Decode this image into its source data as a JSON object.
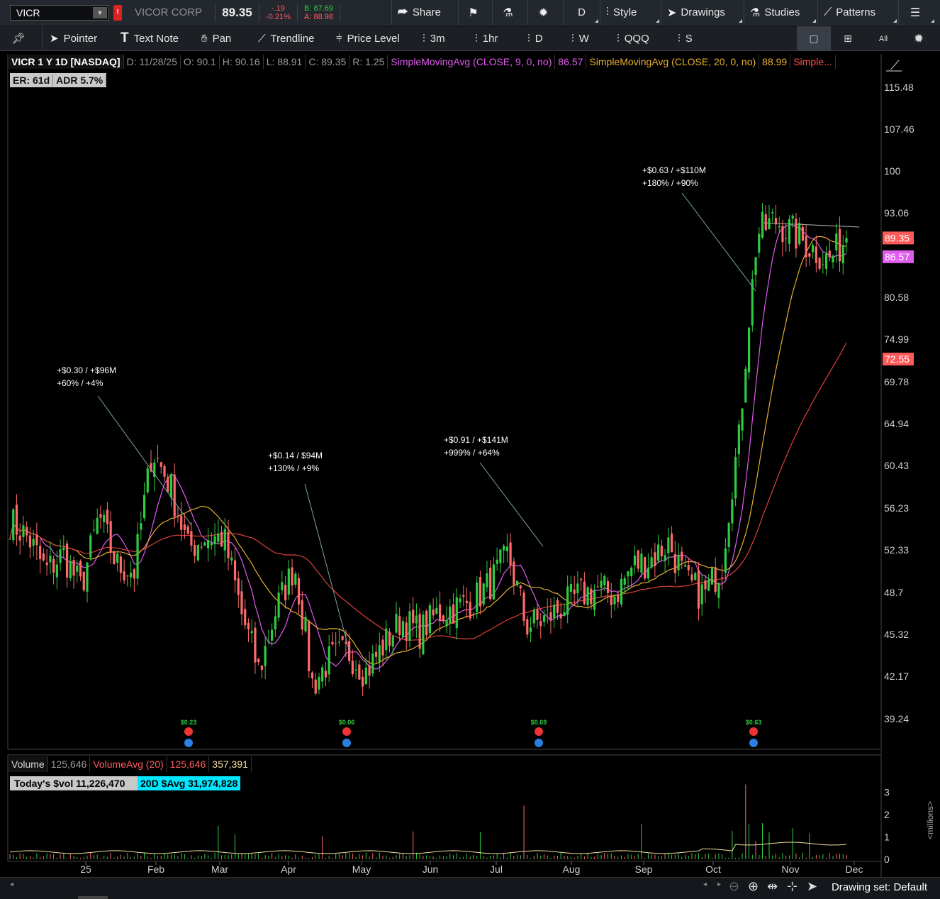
{
  "topbar": {
    "symbol": "VICR",
    "company": "VICOR CORP",
    "last": "89.35",
    "change": "-.19",
    "change_pct": "-0.21%",
    "bid": "B: 87.69",
    "ask": "A: 88.98",
    "share_label": "Share",
    "aggregation": "D",
    "style_label": "Style",
    "drawings_label": "Drawings",
    "studies_label": "Studies",
    "patterns_label": "Patterns"
  },
  "toolbar": {
    "pointer": "Pointer",
    "text_note": "Text Note",
    "pan": "Pan",
    "trendline": "Trendline",
    "price_level": "Price Level",
    "t3m": "3m",
    "t1hr": "1hr",
    "tD": "D",
    "tW": "W",
    "tQQQ": "QQQ",
    "tS": "S",
    "all": "All"
  },
  "chart_info": {
    "title": "VICR 1 Y 1D [NASDAQ]",
    "date": "D: 11/28/25",
    "open": "O: 90.1",
    "high": "H: 90.16",
    "low": "L: 88.91",
    "close": "C: 89.35",
    "range": "R: 1.25",
    "sma9_label": "SimpleMovingAvg (CLOSE, 9, 0, no)",
    "sma9_value": "86.57",
    "sma20_label": "SimpleMovingAvg (CLOSE, 20, 0, no)",
    "sma20_value": "88.99",
    "sma50_label": "Simple...",
    "er": "ER: 61d",
    "adr": "ADR 5.7%"
  },
  "price_axis": [
    "115.48",
    "107.46",
    "100",
    "93.06",
    "80.58",
    "74.99",
    "69.78",
    "64.94",
    "60.43",
    "56.23",
    "52.33",
    "48.7",
    "45.32",
    "42.17",
    "39.24"
  ],
  "price_markers": {
    "last": "89.35",
    "sma9": "86.57",
    "sma50": "72.55",
    "last_color": "#ff5a5a",
    "sma9_color": "#e05cf0",
    "sma50_color": "#ff5a5a"
  },
  "annotations": [
    {
      "l1": "+$0.30 / +$96M",
      "l2": "+60% / +4%"
    },
    {
      "l1": "+$0.14 / $94M",
      "l2": "+130% / +9%"
    },
    {
      "l1": "+$0.91 / +$141M",
      "l2": "+999% / +64%"
    },
    {
      "l1": "+$0.63 / +$110M",
      "l2": "+180% / +90%"
    }
  ],
  "earnings": [
    {
      "eps": "$0.23"
    },
    {
      "eps": "$0.06"
    },
    {
      "eps": "$0.69"
    },
    {
      "eps": "$0.63"
    }
  ],
  "volume_info": {
    "label": "Volume",
    "value": "125,646",
    "avg_label": "VolumeAvg (20)",
    "avg_value": "125,646",
    "avg_value2": "357,391",
    "today_vol": "Today's $vol 11,226,470",
    "avg_dollar": "20D $Avg 31,974,828",
    "axis": [
      "3",
      "2",
      "1",
      "0"
    ],
    "units": "<millions>"
  },
  "time_axis": [
    "25",
    "Feb",
    "Mar",
    "Apr",
    "May",
    "Jun",
    "Jul",
    "Aug",
    "Sep",
    "Oct",
    "Nov",
    "Dec"
  ],
  "bottom": {
    "drawing_set": "Drawing set: Default"
  },
  "colors": {
    "up": "#2ecc40",
    "down": "#ff6b6b",
    "sma9": "#e05cf0",
    "sma20": "#e8b030",
    "sma50": "#e0403a"
  },
  "chart_data": {
    "type": "candlestick",
    "x": [
      "2025-01-02",
      "2025-01-09",
      "2025-01-16",
      "2025-01-23",
      "2025-01-30",
      "2025-02-06",
      "2025-02-13",
      "2025-02-20",
      "2025-02-27",
      "2025-03-06",
      "2025-03-13",
      "2025-03-20",
      "2025-03-27",
      "2025-04-03",
      "2025-04-10",
      "2025-04-17",
      "2025-04-24",
      "2025-05-01",
      "2025-05-08",
      "2025-05-15",
      "2025-05-22",
      "2025-05-29",
      "2025-06-05",
      "2025-06-12",
      "2025-06-19",
      "2025-06-26",
      "2025-07-03",
      "2025-07-10",
      "2025-07-17",
      "2025-07-24",
      "2025-07-31",
      "2025-08-07",
      "2025-08-14",
      "2025-08-21",
      "2025-08-28",
      "2025-09-04",
      "2025-09-11",
      "2025-09-18",
      "2025-09-25",
      "2025-10-02",
      "2025-10-09",
      "2025-10-16",
      "2025-10-23",
      "2025-10-30",
      "2025-11-06",
      "2025-11-13",
      "2025-11-20",
      "2025-11-28"
    ],
    "close": [
      55.0,
      53.5,
      50.5,
      52.0,
      49.0,
      55.5,
      51.0,
      50.5,
      62.0,
      58.5,
      52.5,
      53.5,
      53.5,
      47.0,
      42.5,
      47.5,
      51.0,
      41.5,
      43.5,
      44.0,
      42.5,
      44.5,
      46.5,
      45.5,
      47.0,
      47.5,
      48.0,
      49.5,
      52.0,
      46.0,
      46.5,
      47.5,
      48.5,
      49.0,
      48.5,
      51.0,
      51.5,
      53.0,
      49.5,
      48.5,
      51.0,
      64.0,
      90.0,
      92.0,
      90.0,
      88.0,
      86.0,
      89.35
    ],
    "series": [
      {
        "name": "SimpleMovingAvg (CLOSE, 9, 0, no)",
        "last": 86.57
      },
      {
        "name": "SimpleMovingAvg (CLOSE, 20, 0, no)",
        "last": 88.99
      },
      {
        "name": "Simple...",
        "last": 72.55
      }
    ],
    "ylim": [
      37.5,
      124
    ]
  }
}
